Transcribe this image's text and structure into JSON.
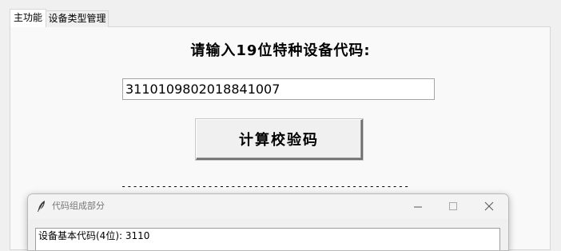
{
  "tabs": [
    {
      "label": "主功能",
      "active": true
    },
    {
      "label": "设备类型管理",
      "active": false
    }
  ],
  "main": {
    "prompt": "请输入19位特种设备代码:",
    "code_value": "3110109802018841007",
    "calc_button_label": "计算校验码",
    "divider": "--------------------------------------------------"
  },
  "popup": {
    "title": "代码组成部分",
    "icon": "feather-icon",
    "line1": "设备基本代码(4位): 3110"
  },
  "colors": {
    "window_bg": "#f0f0f0",
    "panel_bg": "#f9f9f9",
    "border": "#d7d7d7"
  }
}
